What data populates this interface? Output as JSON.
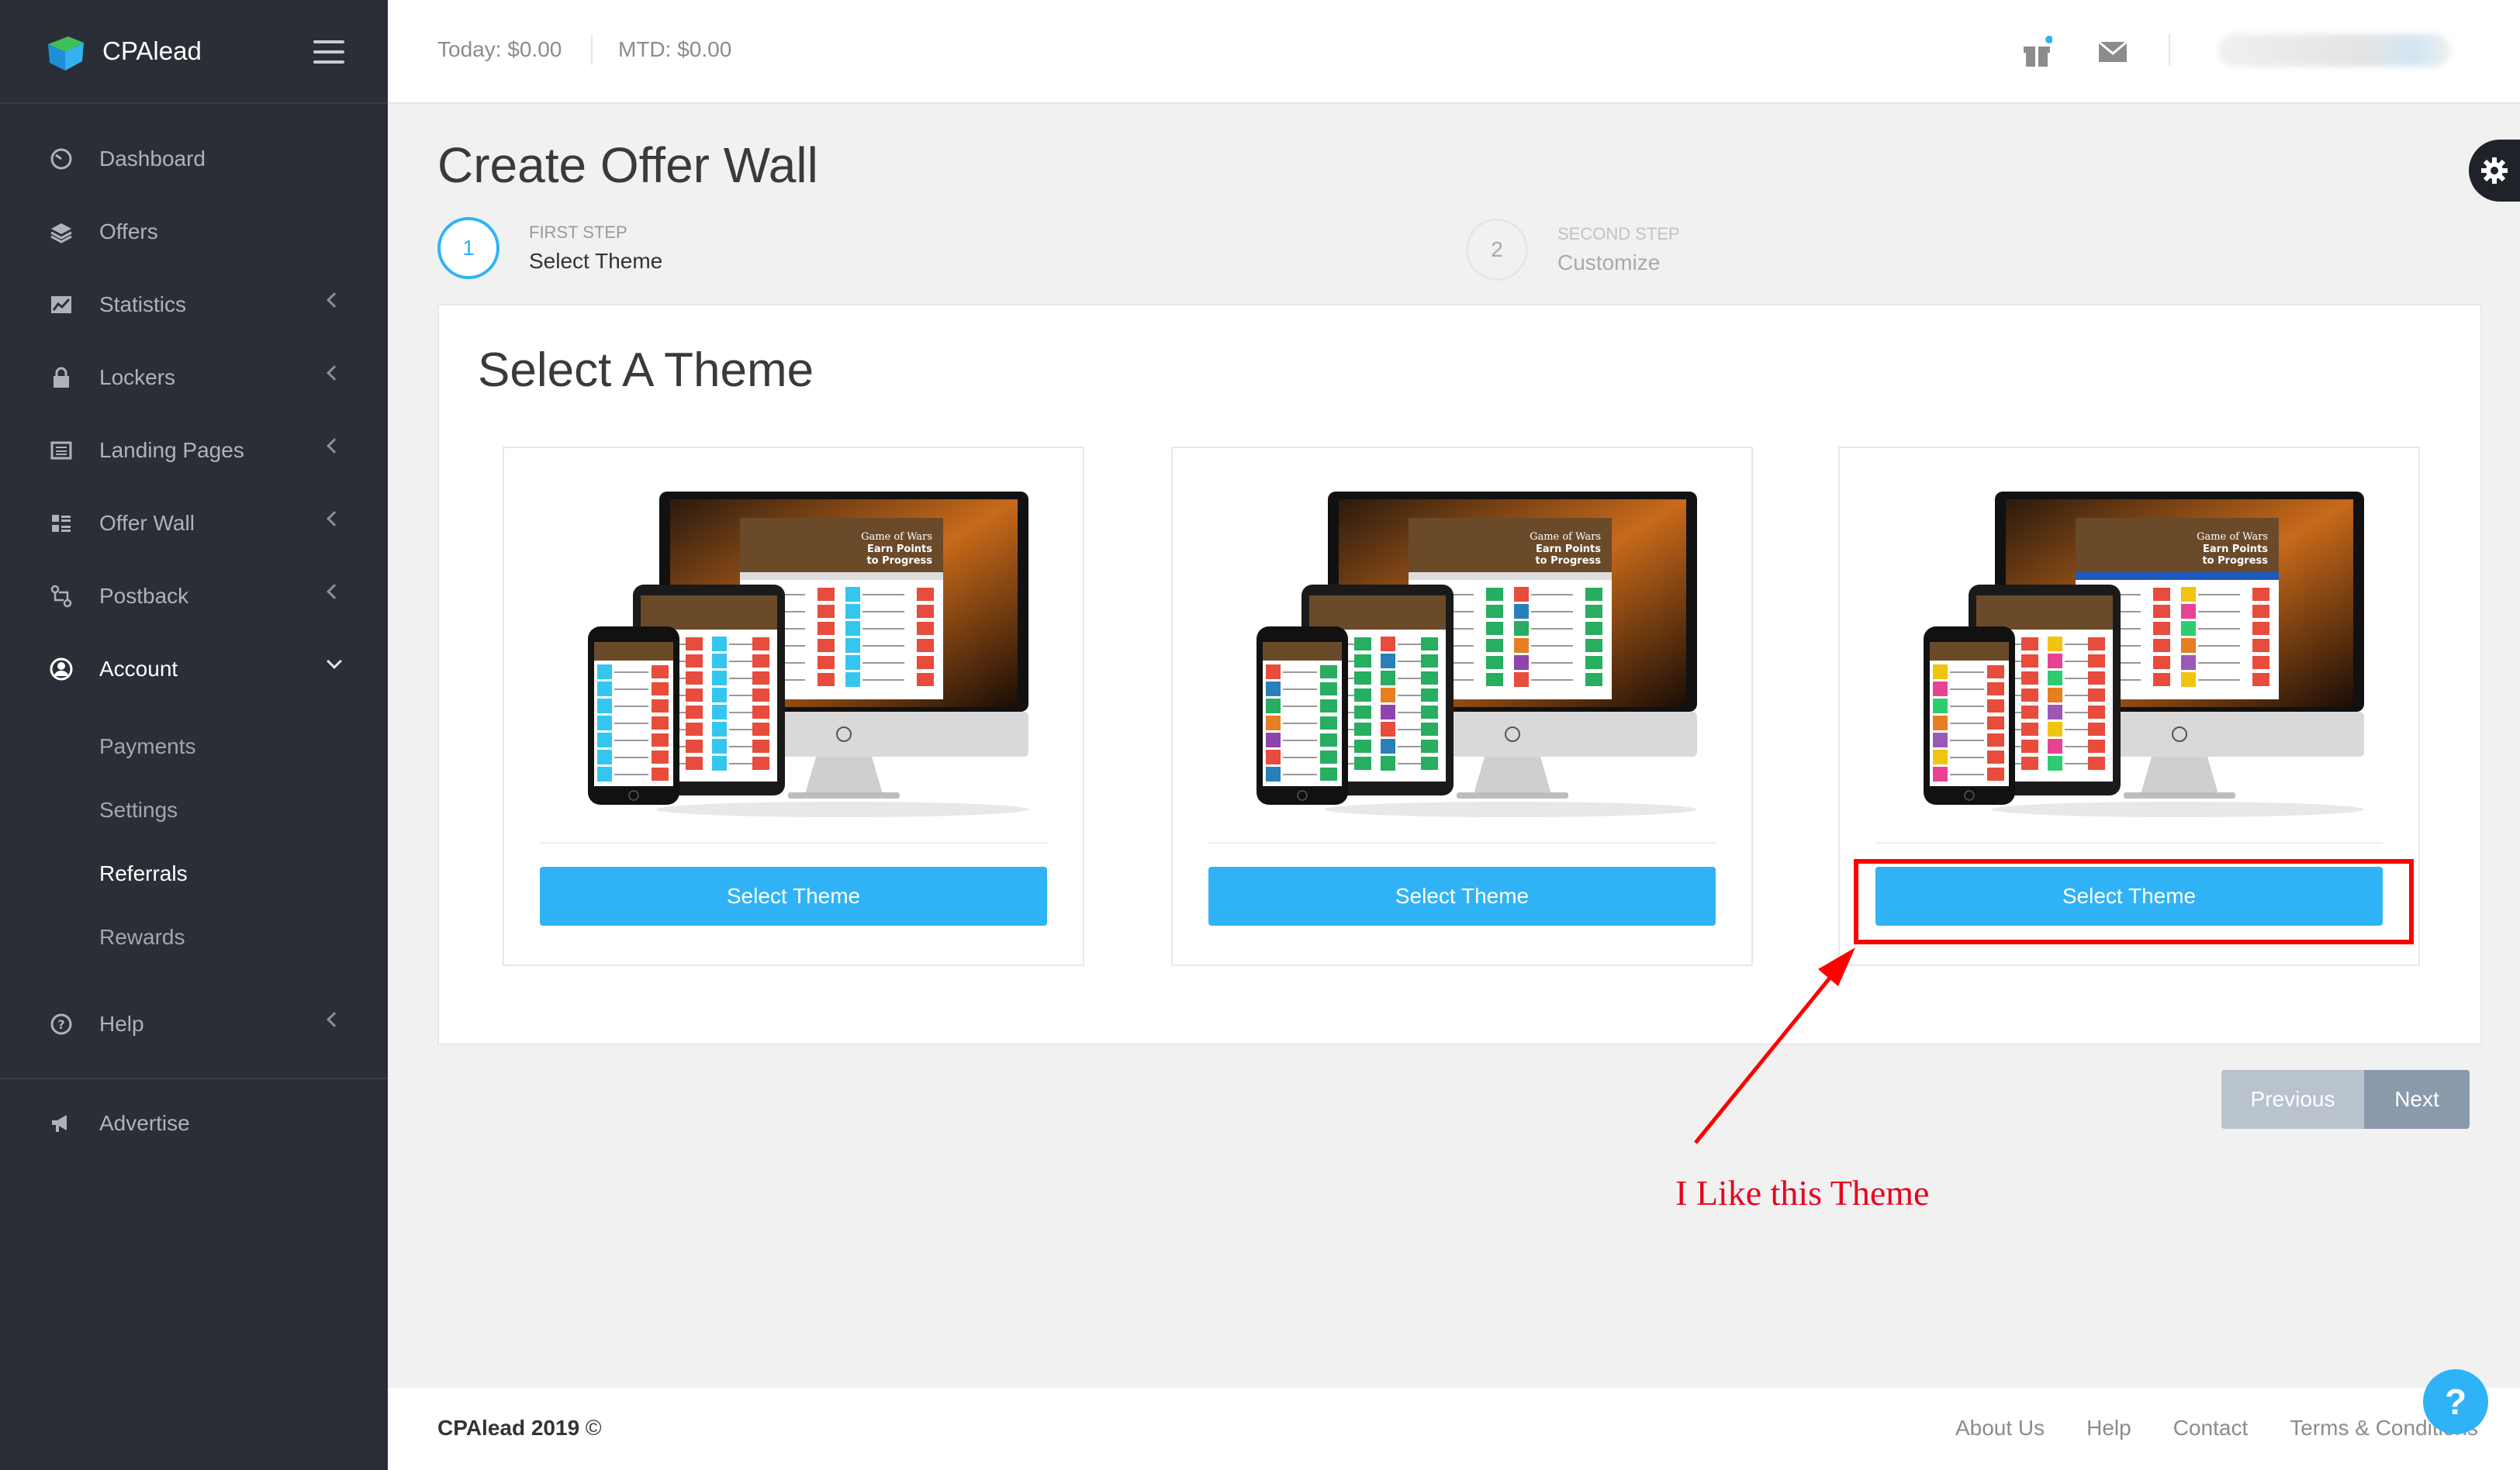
{
  "brand": {
    "name": "CPAlead"
  },
  "header": {
    "today": "Today: $0.00",
    "mtd": "MTD: $0.00"
  },
  "sidebar": {
    "items": [
      {
        "label": "Dashboard",
        "icon": "dashboard-icon"
      },
      {
        "label": "Offers",
        "icon": "layers-icon"
      },
      {
        "label": "Statistics",
        "icon": "chart-icon"
      },
      {
        "label": "Lockers",
        "icon": "lock-icon"
      },
      {
        "label": "Landing Pages",
        "icon": "newspaper-icon"
      },
      {
        "label": "Offer Wall",
        "icon": "grid-list-icon"
      },
      {
        "label": "Postback",
        "icon": "exchange-icon"
      },
      {
        "label": "Account",
        "icon": "user-circle-icon"
      }
    ],
    "account_sub": [
      "Payments",
      "Settings",
      "Referrals",
      "Rewards"
    ],
    "help": {
      "label": "Help",
      "icon": "question-circle-icon"
    },
    "advertise": {
      "label": "Advertise",
      "icon": "megaphone-icon"
    }
  },
  "page": {
    "title": "Create Offer Wall",
    "step1": {
      "number": "1",
      "caption": "FIRST STEP",
      "label": "Select Theme"
    },
    "step2": {
      "number": "2",
      "caption": "SECOND STEP",
      "label": "Customize"
    }
  },
  "panel": {
    "title": "Select A Theme",
    "themes": [
      {
        "button": "Select Theme"
      },
      {
        "button": "Select Theme"
      },
      {
        "button": "Select Theme"
      }
    ]
  },
  "mockup_text": {
    "line1": "Game of Wars",
    "line2": "Earn Points",
    "line3": "to Progress"
  },
  "pager": {
    "previous": "Previous",
    "next": "Next"
  },
  "annotation": {
    "text": "I Like this Theme"
  },
  "footer": {
    "brand": "CPAlead 2019",
    "copy_symbol": "©",
    "links": [
      "About Us",
      "Help",
      "Contact",
      "Terms & Conditions"
    ]
  },
  "colors": {
    "accent": "#30b3f6",
    "sidebar": "#2a2e37",
    "annotation": "#ff0000"
  }
}
